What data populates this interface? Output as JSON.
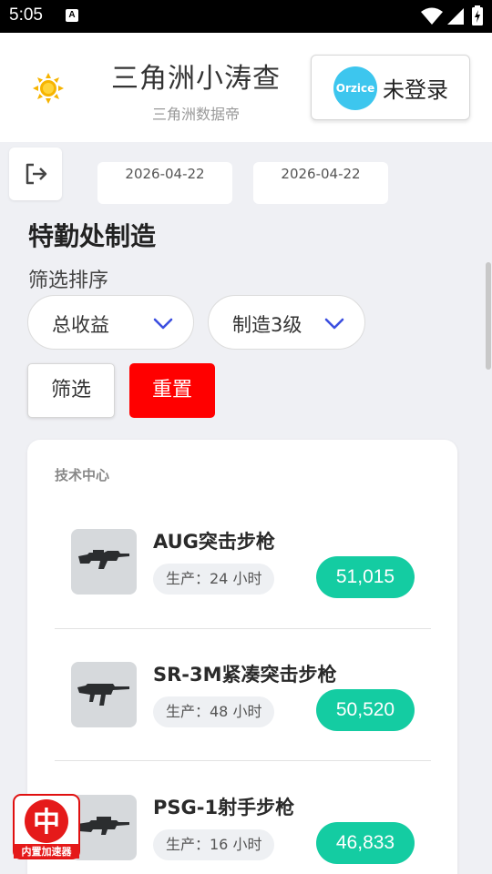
{
  "status_bar": {
    "time": "5:05",
    "a_icon": "A"
  },
  "header": {
    "theme_icon": "sun-icon",
    "title": "三角洲小涛查",
    "subtitle": "三角洲数据帝",
    "login": {
      "logo_text": "Orzice",
      "label": "未登录"
    }
  },
  "toolbar": {
    "logout_icon": "logout-icon"
  },
  "dates": [
    "2026-04-22",
    "2026-04-22"
  ],
  "section": {
    "title": "特勤处制造",
    "filter_label": "筛选排序",
    "sort_select": "总收益",
    "level_select": "制造3级",
    "filter_button": "筛选",
    "reset_button": "重置"
  },
  "card": {
    "title": "技术中心",
    "items": [
      {
        "name": "AUG突击步枪",
        "time": "生产：24 小时",
        "value": "51,015"
      },
      {
        "name": "SR-3M紧凑突击步枪",
        "time": "生产：48 小时",
        "value": "50,520"
      },
      {
        "name": "PSG-1射手步枪",
        "time": "生产：16 小时",
        "value": "46,833"
      }
    ]
  },
  "float_badge": {
    "char": "中",
    "label": "内置加速器"
  },
  "colors": {
    "accent_green": "#14cca2",
    "reset_red": "#ff0000",
    "select_arrow": "#3b4ee0",
    "logo_blue": "#3dc6ee"
  }
}
